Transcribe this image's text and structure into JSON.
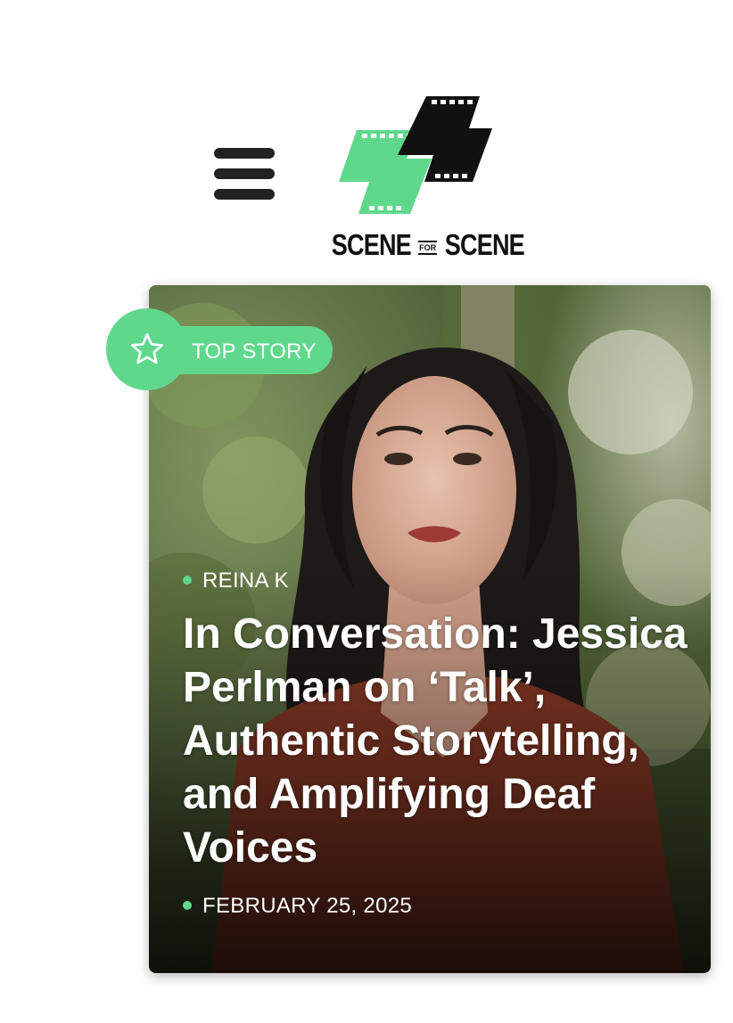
{
  "header": {
    "menu_icon": "hamburger-menu-icon",
    "logo": {
      "icon": "film-strip-bolt-logo",
      "word_left": "SCENE",
      "word_small": "FOR",
      "word_right": "SCENE",
      "colors": {
        "green": "#5fd88c",
        "black": "#111111"
      }
    }
  },
  "story": {
    "badge_label": "TOP STORY",
    "badge_icon": "star-icon",
    "author": "REINA K",
    "title": "In Conversation: Jessica Perlman on ‘Talk’, Authentic Storytelling, and Amplifying Deaf Voices",
    "date": "FEBRUARY 25, 2025",
    "accent_color": "#5fd88c"
  }
}
